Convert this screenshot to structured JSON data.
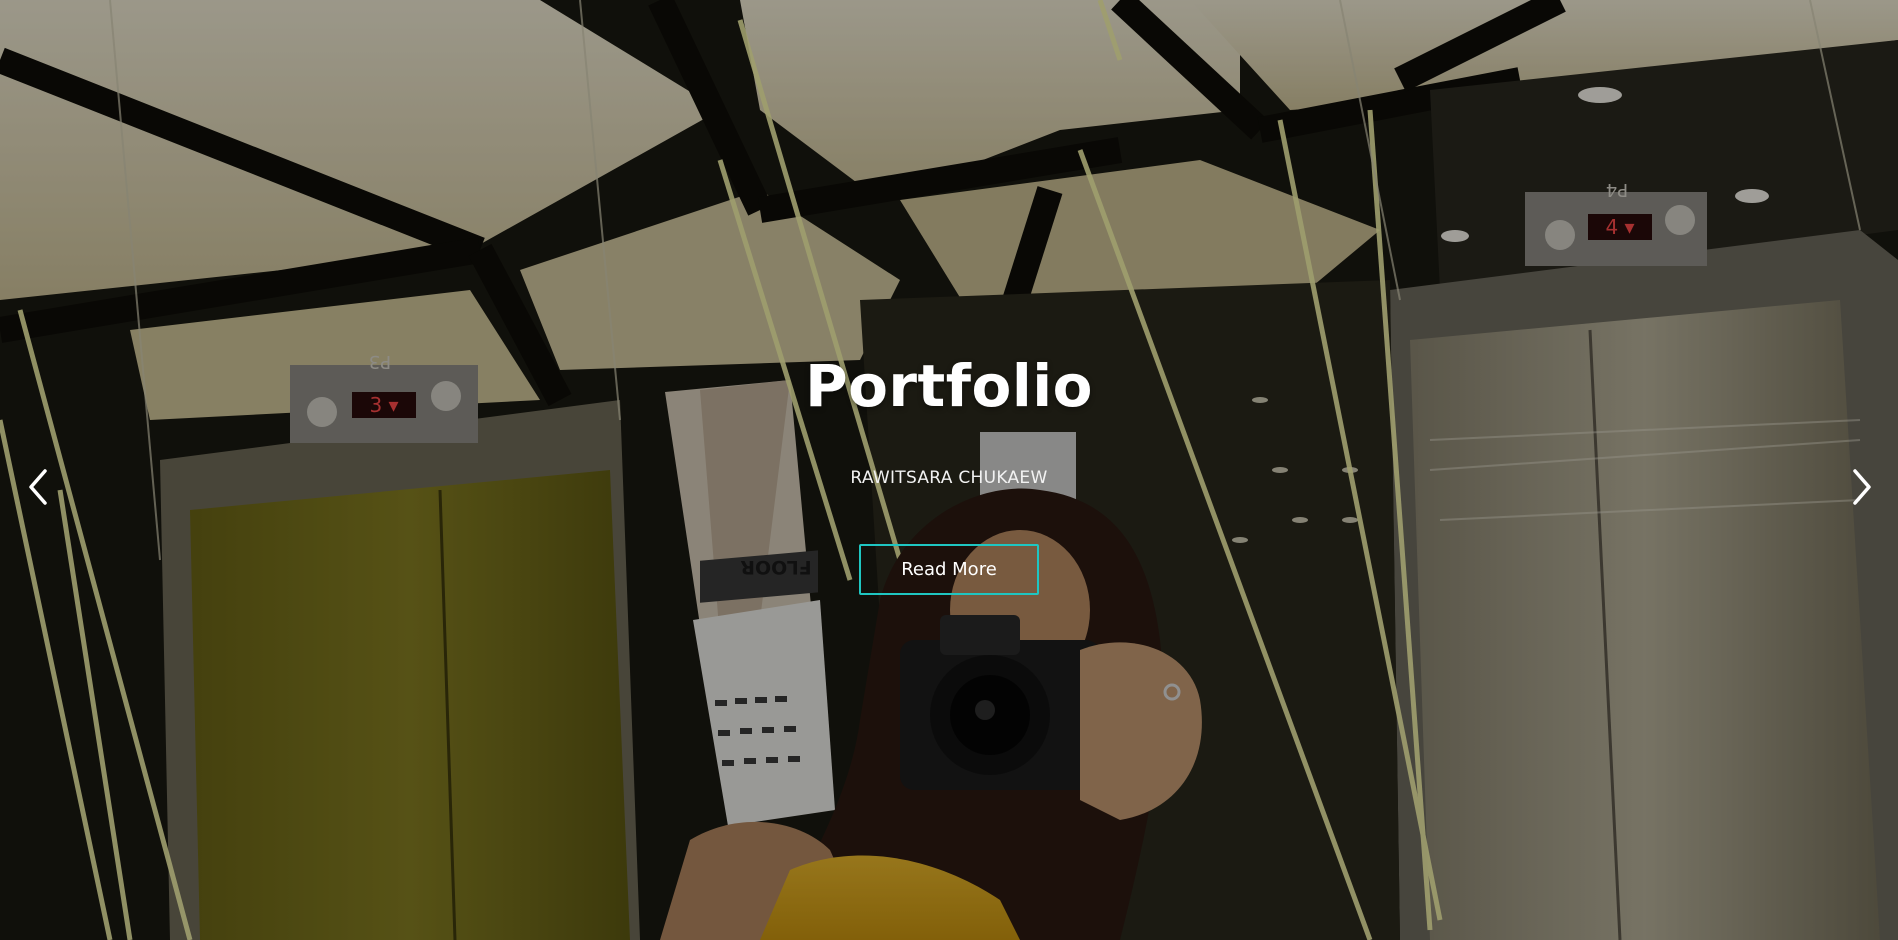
{
  "slider": {
    "title": "Portfolio",
    "subtitle": "RAWITSARA CHUKAEW",
    "button_label": "Read More",
    "accent_color": "#1fc6c2",
    "prev_icon": "chevron-left-icon",
    "next_icon": "chevron-right-icon"
  },
  "scene": {
    "left_elevator_display": "P3",
    "right_elevator_display": "P4",
    "sign_text": "FLOOR"
  }
}
